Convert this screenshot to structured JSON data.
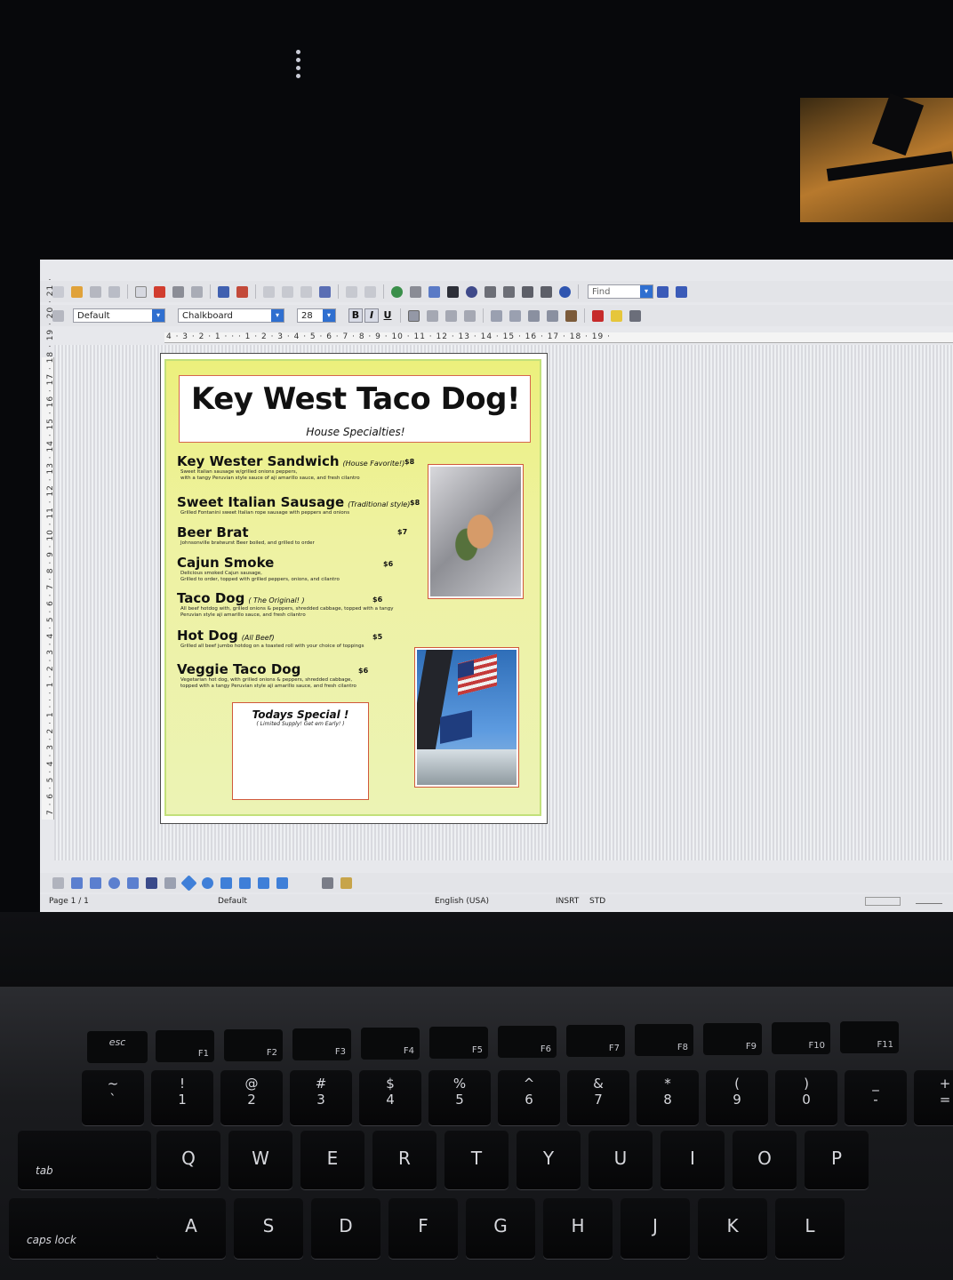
{
  "toolbar": {
    "style": "Default",
    "font": "Chalkboard",
    "size": "28",
    "bold": "B",
    "italic": "I",
    "underline": "U",
    "find_placeholder": "Find"
  },
  "ruler": {
    "horizontal": "4 · 3 · 2 · 1 · · · 1 · 2 · 3 · 4 · 5 · 6 · 7 · 8 · 9 · 10 · 11 · 12 · 13 · 14 · 15 · 16 · 17 · 18 · 19 ·",
    "vertical": "7 · 6 · 5 · 4 · 3 · 2 · 1 · · · 1 · 2 · 3 · 4 · 5 · 6 · 7 · 8 · 9 · 10 · 11 · 12 · 13 · 14 · 15 · 16 · 17 · 18 · 19 · 20 · 21 ·"
  },
  "document": {
    "title": "Key West Taco Dog!",
    "subtitle": "House Specialties!",
    "items": [
      {
        "name": "Key Wester Sandwich",
        "note": "(House Favorite!)",
        "price": "$8",
        "desc": [
          "Sweet Italian sausage w/grilled onions peppers,",
          "with a tangy Peruvian style sauce of aji amarillo sauce, and fresh cilantro"
        ]
      },
      {
        "name": "Sweet Italian Sausage",
        "note": "(Traditional style)",
        "price": "$8",
        "desc": [
          "Grilled Fontanini sweet Italian rope sausage with peppers and onions"
        ]
      },
      {
        "name": "Beer Brat",
        "note": "",
        "price": "$7",
        "desc": [
          "Johnsonville bratwurst Beer boiled, and grilled to order"
        ]
      },
      {
        "name": "Cajun Smoke",
        "note": "",
        "price": "$6",
        "desc": [
          "Delicious smoked Cajun sausage,",
          "Grilled to order, topped with grilled peppers, onions, and cilantro"
        ]
      },
      {
        "name": "Taco Dog",
        "note": "( The Original! )",
        "price": "$6",
        "desc": [
          "All beef hotdog with, grilled onions & peppers, shredded cabbage, topped with a tangy",
          "Peruvian style aji amarillo sauce, and fresh cilantro"
        ]
      },
      {
        "name": "Hot Dog",
        "note": "(All Beef)",
        "price": "$5",
        "desc": [
          "Grilled all beef jumbo hotdog on a toasted roll with your choice of toppings"
        ]
      },
      {
        "name": "Veggie Taco Dog",
        "note": "",
        "price": "$6",
        "desc": [
          "Vegetarian hot dog, with grilled onions & peppers, shredded cabbage,",
          "topped with a tangy Peruvian style aji amarillo sauce, and fresh cilantro"
        ]
      }
    ],
    "special_title": "Todays Special !",
    "special_sub": "( Limited Supply! Get em Early! )"
  },
  "statusbar": {
    "page": "Page 1 / 1",
    "style": "Default",
    "language": "English (USA)",
    "insert": "INSRT",
    "selection": "STD"
  },
  "keyboard": {
    "fn_row": [
      "esc",
      "F1",
      "F2",
      "F3",
      "F4",
      "F5",
      "F6",
      "F7",
      "F8",
      "F9",
      "F10",
      "F11"
    ],
    "num_row": [
      {
        "top": "~",
        "bot": "`"
      },
      {
        "top": "!",
        "bot": "1"
      },
      {
        "top": "@",
        "bot": "2"
      },
      {
        "top": "#",
        "bot": "3"
      },
      {
        "top": "$",
        "bot": "4"
      },
      {
        "top": "%",
        "bot": "5"
      },
      {
        "top": "^",
        "bot": "6"
      },
      {
        "top": "&",
        "bot": "7"
      },
      {
        "top": "*",
        "bot": "8"
      },
      {
        "top": "(",
        "bot": "9"
      },
      {
        "top": ")",
        "bot": "0"
      },
      {
        "top": "_",
        "bot": "-"
      },
      {
        "top": "+",
        "bot": "="
      }
    ],
    "tab": "tab",
    "qwerty": [
      "Q",
      "W",
      "E",
      "R",
      "T",
      "Y",
      "U",
      "I",
      "O",
      "P"
    ],
    "caps": "caps lock",
    "asdf": [
      "A",
      "S",
      "D",
      "F",
      "G",
      "H",
      "J",
      "K",
      "L"
    ]
  },
  "colors": {
    "menu_bg": "#eef2a2",
    "accent_border": "#d0583b",
    "select_arrow": "#2f6fd0"
  }
}
